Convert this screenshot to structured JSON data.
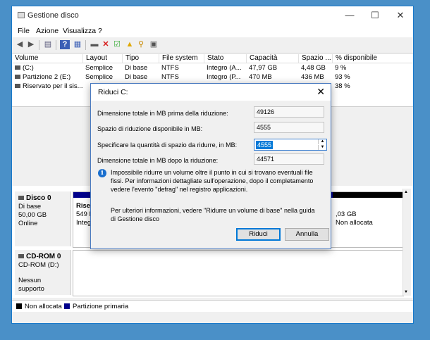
{
  "window": {
    "title": "Gestione disco",
    "minimize": "—",
    "maximize": "☐",
    "close": "✕"
  },
  "menu": [
    "File",
    "Azione",
    "Visualizza",
    "?"
  ],
  "toolbar_icons": [
    "back-icon",
    "forward-icon",
    "console-icon",
    "help-icon",
    "properties-icon",
    "connect-icon",
    "delete-icon",
    "check-icon",
    "export-icon",
    "search-icon",
    "settings-icon"
  ],
  "volume_table": {
    "columns": [
      "Volume",
      "Layout",
      "Tipo",
      "File system",
      "Stato",
      "Capacità",
      "Spazio ...",
      "% disponibile"
    ],
    "rows": [
      [
        "(C:)",
        "Semplice",
        "Di base",
        "NTFS",
        "Integro (A...",
        "47,97 GB",
        "4,48 GB",
        "9 %"
      ],
      [
        "Partizione 2 (E:)",
        "Semplice",
        "Di base",
        "NTFS",
        "Integro (P...",
        "470 MB",
        "436 MB",
        "93 %"
      ],
      [
        "Riservato per il sis...",
        "",
        "",
        "",
        "",
        "",
        "",
        "38 %"
      ]
    ]
  },
  "disks": [
    {
      "name": "Disco 0",
      "type": "Di base",
      "size": "50,00 GB",
      "status": "Online",
      "part1_title": "Riser",
      "part1_l2": "549 N",
      "part1_l3": "Integ",
      "part_right_l1": ",03 GB",
      "part_right_l2": "Non allocata"
    },
    {
      "name": "CD-ROM 0",
      "type": "CD-ROM (D:)",
      "status": "Nessun supporto"
    }
  ],
  "legend": [
    {
      "label": "Non allocata",
      "color": "#000000"
    },
    {
      "label": "Partizione primaria",
      "color": "#00008b"
    }
  ],
  "dialog": {
    "title": "Riduci C:",
    "total_before_label": "Dimensione totale in MB prima della riduzione:",
    "total_before": "49126",
    "available_label": "Spazio di riduzione disponibile in MB:",
    "available": "4555",
    "amount_label": "Specificare la quantità di spazio da ridurre, in MB:",
    "amount": "4555",
    "total_after_label": "Dimensione totale in MB dopo la riduzione:",
    "total_after": "44571",
    "info_text": "Impossibile ridurre un volume oltre il punto in cui si trovano eventuali file fissi. Per informazioni dettagliate sull'operazione, dopo il completamento vedere l'evento \"defrag\" nel registro applicazioni.",
    "note": "Per ulteriori informazioni, vedere \"Ridurre un volume di base\" nella guida di Gestione disco",
    "ok": "Riduci",
    "cancel": "Annulla"
  }
}
